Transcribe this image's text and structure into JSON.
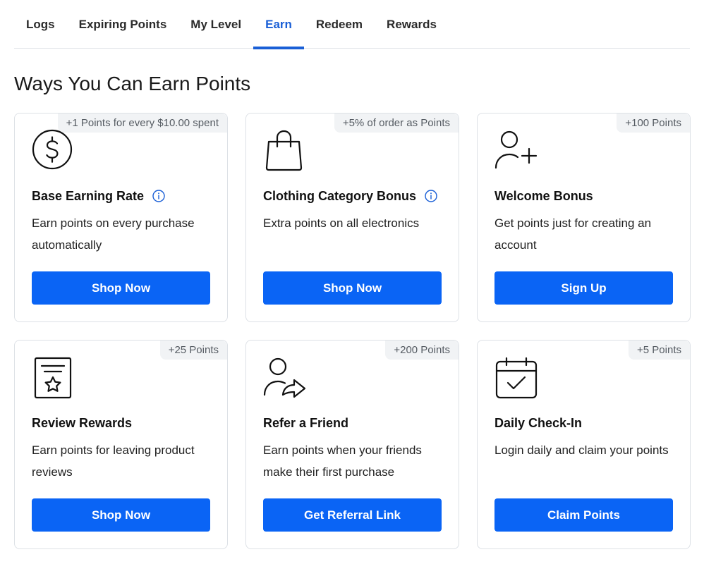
{
  "tabs": [
    {
      "label": "Logs",
      "active": false
    },
    {
      "label": "Expiring Points",
      "active": false
    },
    {
      "label": "My Level",
      "active": false
    },
    {
      "label": "Earn",
      "active": true
    },
    {
      "label": "Redeem",
      "active": false
    },
    {
      "label": "Rewards",
      "active": false
    }
  ],
  "section_title": "Ways You Can Earn Points",
  "colors": {
    "accent": "#1a5fd6",
    "button": "#0a64f5",
    "badge_bg": "#f1f3f5",
    "border": "#dde1e6"
  },
  "cards": [
    {
      "badge": "+1 Points for every $10.00 spent",
      "icon": "dollar-coin-icon",
      "title": "Base Earning Rate",
      "has_info": true,
      "description": "Earn points on every purchase automatically",
      "button": "Shop Now"
    },
    {
      "badge": "+5% of order as Points",
      "icon": "shopping-bag-icon",
      "title": "Clothing Category Bonus",
      "has_info": true,
      "description": "Extra points on all electronics",
      "button": "Shop Now"
    },
    {
      "badge": "+100 Points",
      "icon": "user-plus-icon",
      "title": "Welcome Bonus",
      "has_info": false,
      "description": "Get points just for creating an account",
      "button": "Sign Up"
    },
    {
      "badge": "+25 Points",
      "icon": "review-star-icon",
      "title": "Review Rewards",
      "has_info": false,
      "description": "Earn points for leaving product reviews",
      "button": "Shop Now"
    },
    {
      "badge": "+200 Points",
      "icon": "user-share-icon",
      "title": "Refer a Friend",
      "has_info": false,
      "description": "Earn points when your friends make their first purchase",
      "button": "Get Referral Link"
    },
    {
      "badge": "+5 Points",
      "icon": "calendar-check-icon",
      "title": "Daily Check-In",
      "has_info": false,
      "description": "Login daily and claim your points",
      "button": "Claim Points"
    }
  ]
}
